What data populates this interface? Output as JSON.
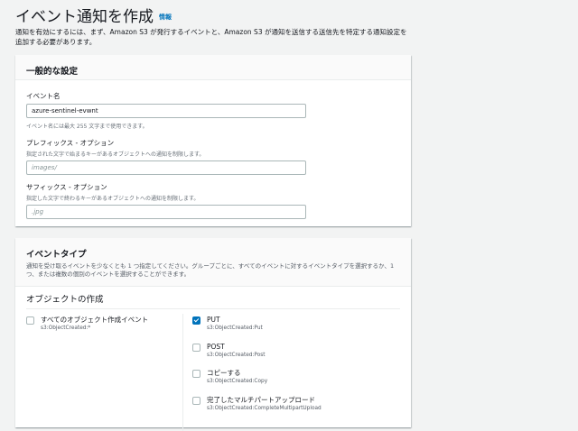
{
  "page": {
    "title": "イベント通知を作成",
    "info_link": "情報",
    "description": "通知を有効にするには、まず、Amazon S3 が発行するイベントと、Amazon S3 が通知を送信する送信先を特定する通知設定を追加する必要があります。"
  },
  "general": {
    "title": "一般的な設定",
    "event_name": {
      "label": "イベント名",
      "value": "azure-sentinel-evwnt",
      "hint": "イベント名には最大 255 文字まで使用できます。"
    },
    "prefix": {
      "label": "プレフィックス - オプション",
      "description": "指定された文字で始まるキーがあるオブジェクトへの通知を制限します。",
      "placeholder": "images/"
    },
    "suffix": {
      "label": "サフィックス - オプション",
      "description": "指定した文字で終わるキーがあるオブジェクトへの通知を制限します。",
      "placeholder": ".jpg"
    }
  },
  "event_types": {
    "title": "イベントタイプ",
    "description": "通知を受け取るイベントを少なくとも 1 つ指定してください。グループごとに、すべてのイベントに対するイベントタイプを選択するか、1 つ、または複数の個別のイベントを選択することができます。",
    "object_creation": {
      "heading": "オブジェクトの作成",
      "all": {
        "label": "すべてのオブジェクト作成イベント",
        "code": "s3:ObjectCreated:*",
        "checked": false
      },
      "items": [
        {
          "label": "PUT",
          "code": "s3:ObjectCreated:Put",
          "checked": true
        },
        {
          "label": "POST",
          "code": "s3:ObjectCreated:Post",
          "checked": false
        },
        {
          "label": "コピーする",
          "code": "s3:ObjectCreated:Copy",
          "checked": false
        },
        {
          "label": "完了したマルチパートアップロード",
          "code": "s3:ObjectCreated:CompleteMultipartUpload",
          "checked": false
        }
      ]
    }
  },
  "colors": {
    "background": "#f2f3f3",
    "link": "#0073bb",
    "checkbox_checked": "#0073bb",
    "text": "#16191f",
    "secondary_text": "#687078"
  }
}
